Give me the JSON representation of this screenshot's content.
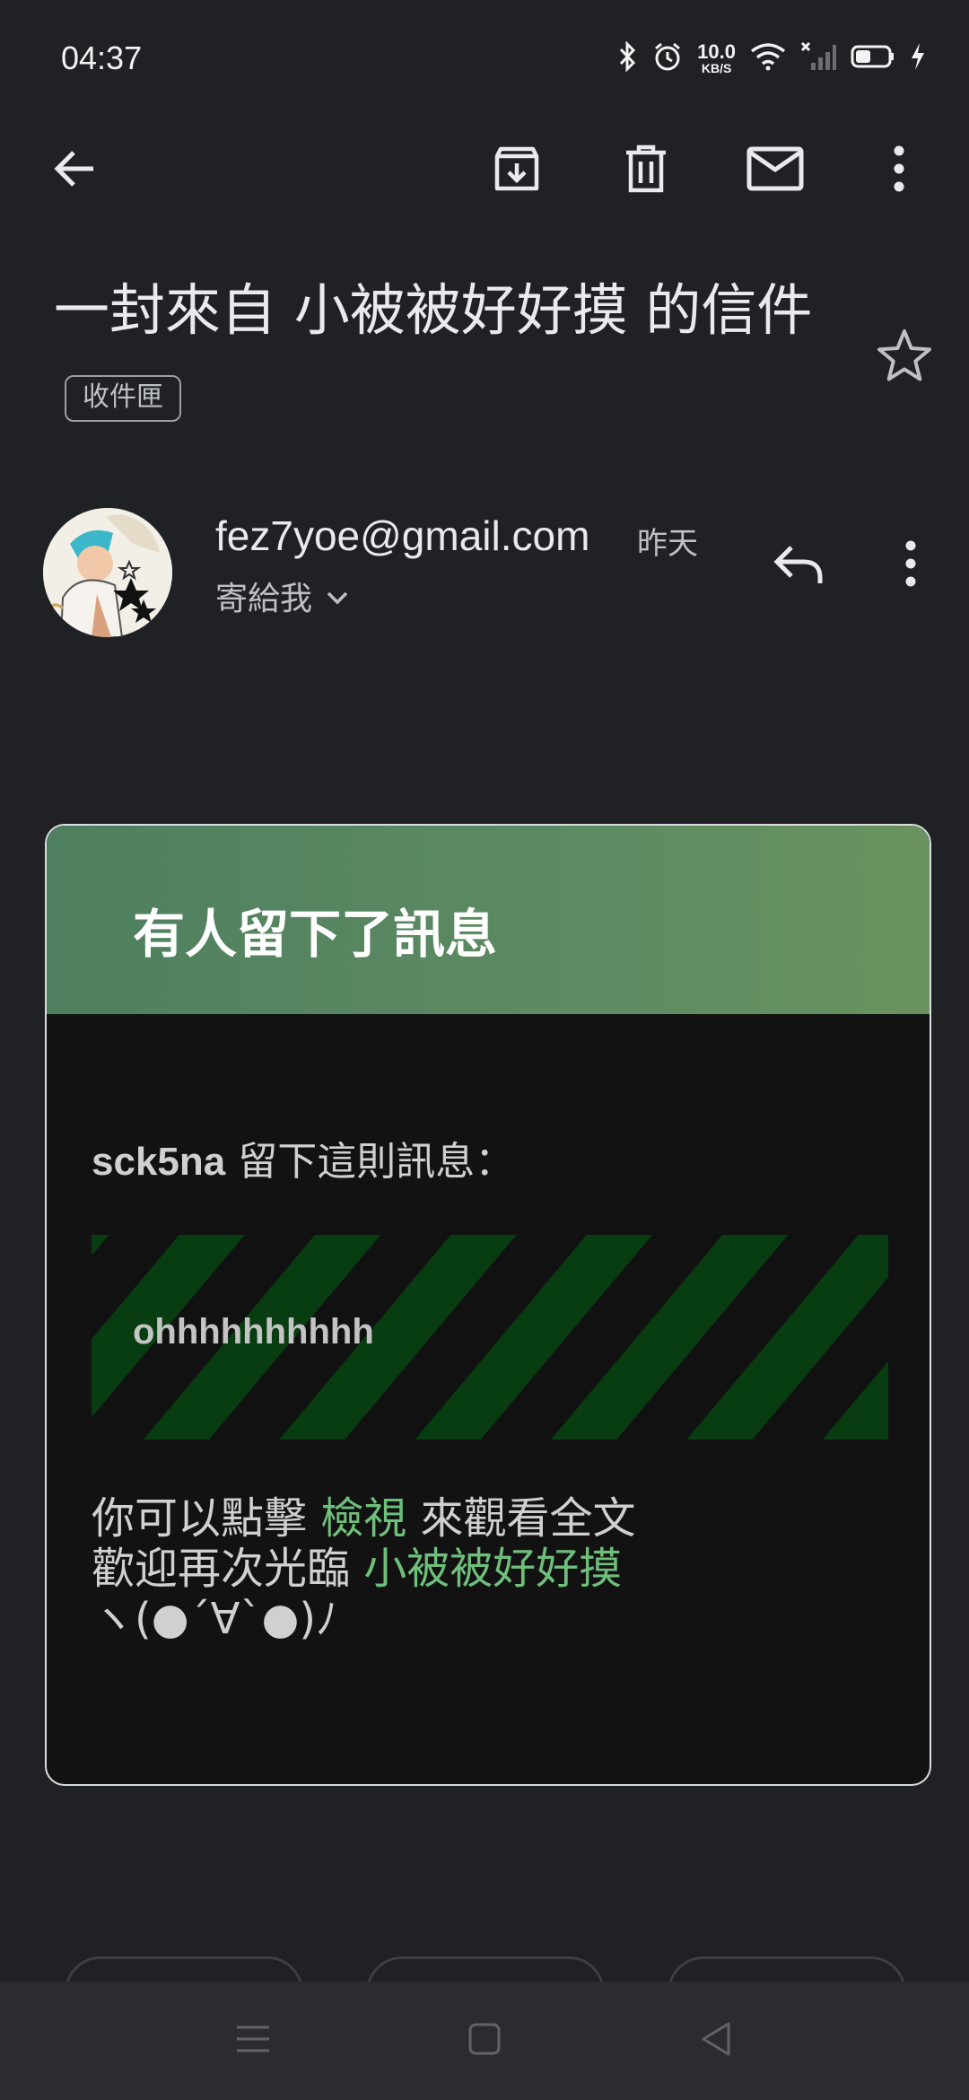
{
  "status_bar": {
    "time": "04:37",
    "net_speed_value": "10.0",
    "net_speed_unit": "KB/S",
    "icons": [
      "bluetooth-icon",
      "alarm-icon",
      "wifi-icon",
      "signal-icon",
      "battery-icon",
      "charging-icon"
    ]
  },
  "toolbar": {
    "icons": [
      "back-arrow-icon",
      "archive-icon",
      "trash-icon",
      "mail-icon",
      "more-vert-icon"
    ]
  },
  "email": {
    "subject": "一封來自 小被被好好摸 的信件",
    "label_chip": "收件匣",
    "sender": "fez7yoe@gmail.com",
    "date": "昨天",
    "recipient": "寄給我"
  },
  "card": {
    "title": "有人留下了訊息",
    "intro_user": "sck5na",
    "intro_text": " 留下這則訊息：",
    "message": "ohhhhhhhhhh",
    "line1_prefix": "你可以點擊 ",
    "line1_link": "檢視",
    "line1_suffix": " 來觀看全文",
    "line2_prefix": "歡迎再次光臨 ",
    "line2_link": "小被被好好摸",
    "line3": "ヽ(●´∀`●)ﾉ",
    "colors": {
      "header_green": "#5d8b62",
      "stripe_green": "#073d10",
      "link_green": "#6fbf7c"
    }
  },
  "nav_bar": {
    "icons": [
      "recents-icon",
      "home-icon",
      "back-triangle-icon"
    ]
  }
}
